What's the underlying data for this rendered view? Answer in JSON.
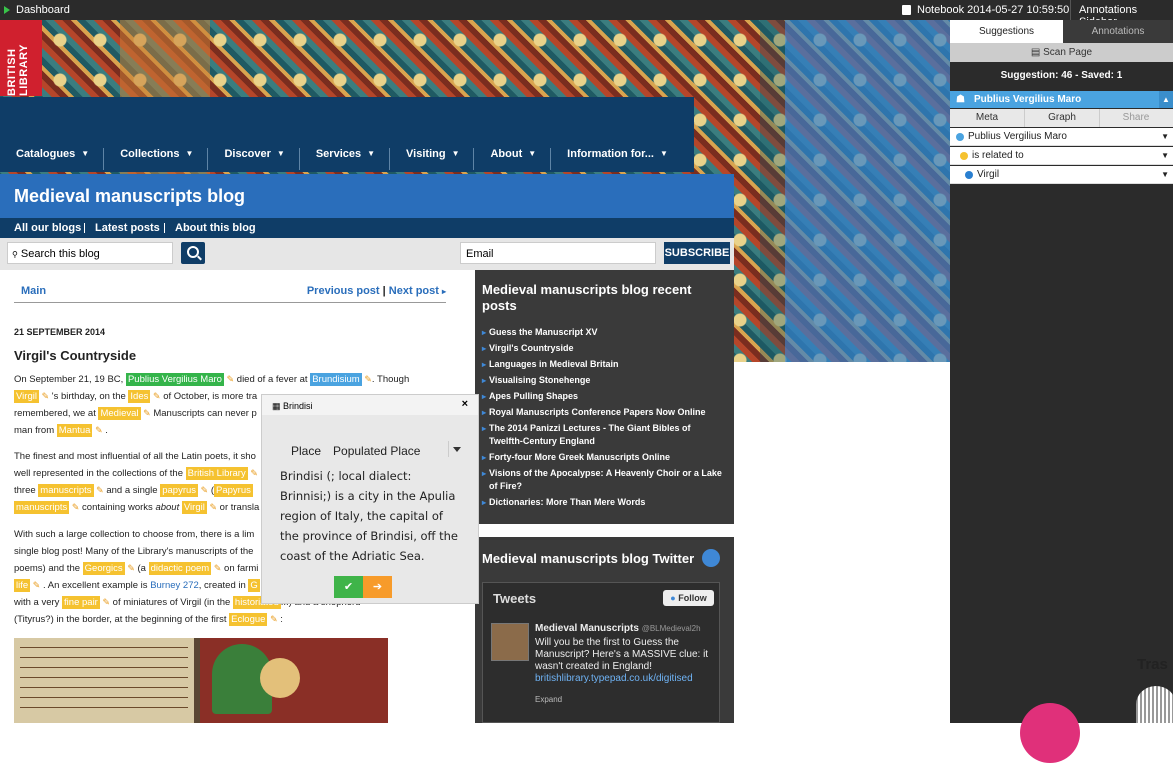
{
  "topbar": {
    "dashboard": "Dashboard",
    "notebook": "Notebook 2014-05-27 10:59:50",
    "annotations_sidebar": "Annotations Sidebar"
  },
  "logo": {
    "text": "BRITISH LIBRARY"
  },
  "nav": {
    "items": [
      "Catalogues",
      "Collections",
      "Discover",
      "Services",
      "Visiting",
      "About",
      "Information for..."
    ]
  },
  "blog": {
    "title": "Medieval manuscripts blog"
  },
  "sublinks": [
    "All our blogs",
    "Latest posts",
    "About this blog"
  ],
  "search": {
    "placeholder": "Search this blog",
    "email_placeholder": "Email",
    "subscribe": "SUBSCRIBE"
  },
  "post": {
    "main_link": "Main",
    "prev": "Previous post",
    "next": "Next post",
    "date": "21 SEPTEMBER 2014",
    "title": "Virgil's Countryside",
    "p1": [
      "On September 21, 19 BC, ",
      "Publius Vergilius Maro",
      " died of a fever at ",
      "Brundisium",
      ". Though ",
      "Virgil",
      " 's birthday, on the ",
      "Ides",
      " of October, is more tra",
      "remembered, we at ",
      "Medieval",
      " Manuscripts can never p",
      "man from ",
      "Mantua",
      " ."
    ],
    "p2": [
      "The finest and most influential of all the Latin poets, it sho",
      "well represented in the collections of the ",
      "British Library",
      "three ",
      "manuscripts",
      " and a single ",
      "papyrus",
      " (",
      "Papyrus",
      "manuscripts",
      " containing works ",
      "about",
      " ",
      "Virgil",
      " or transla"
    ],
    "p3": [
      "With such a large collection to choose from, there is a lim",
      "single blog post! Many of the Library's manuscripts of the",
      "poems) and the ",
      "Georgics",
      " (a ",
      "didactic poem",
      " on farmi",
      "life",
      " . An excellent example is ",
      "Burney 272",
      ", created in ",
      "G",
      "with a very ",
      "fine pair",
      " of miniatures of Virgil (in the ",
      "historiated",
      "...) and a shepherd",
      "(Tityrus?) in the border, at the beginning of the first ",
      "Eclogue",
      " :"
    ]
  },
  "recent": {
    "heading": "Medieval manuscripts blog recent posts",
    "items": [
      "Guess the Manuscript XV",
      "Virgil's Countryside",
      "Languages in Medieval Britain",
      "Visualising Stonehenge",
      "Apes Pulling Shapes",
      "Royal Manuscripts Conference Papers Now Online",
      "The 2014 Panizzi Lectures - The Giant Bibles of Twelfth-Century England",
      "Forty-four More Greek Manuscripts Online",
      "Visions of the Apocalypse: A Heavenly Choir or a Lake of Fire?",
      "Dictionaries: More Than Mere Words"
    ]
  },
  "twitter": {
    "heading": "Medieval manuscripts blog Twitter",
    "tweets": "Tweets",
    "follow": "Follow",
    "name": "Medieval Manuscripts",
    "handle": "@BLMedieval",
    "time": "2h",
    "body": "Will you be the first to Guess the Manuscript? Here's a MASSIVE clue: it wasn't created in England!",
    "link": "britishlibrary.typepad.co.uk/digitised",
    "expand": "Expand"
  },
  "popup": {
    "title": "Brindisi",
    "type1": "Place",
    "type2": "Populated Place",
    "description": "Brindisi (; local dialect: Brinnisi;) is a city in the Apulia region of Italy, the capital of the province of Brindisi, off the coast of the Adriatic Sea.",
    "ok": "✔",
    "go": "➔"
  },
  "sidebar": {
    "tab_suggestions": "Suggestions",
    "tab_annotations": "Annotations",
    "scan_page": "Scan Page",
    "suggestion_status": "Suggestion: 46 - Saved: 1",
    "entity": "Publius Vergilius Maro",
    "subtabs": [
      "Meta",
      "Graph",
      "Share"
    ],
    "subject": "Publius Vergilius Maro",
    "predicate": "is related to",
    "object": "Virgil"
  },
  "trash": {
    "label": "Tras"
  },
  "colors": {
    "accent_blue": "#2a6ebb",
    "navy": "#0f3d67",
    "highlight": "#f5c230",
    "green": "#34b44a",
    "entity_blue": "#4aa3e0"
  }
}
